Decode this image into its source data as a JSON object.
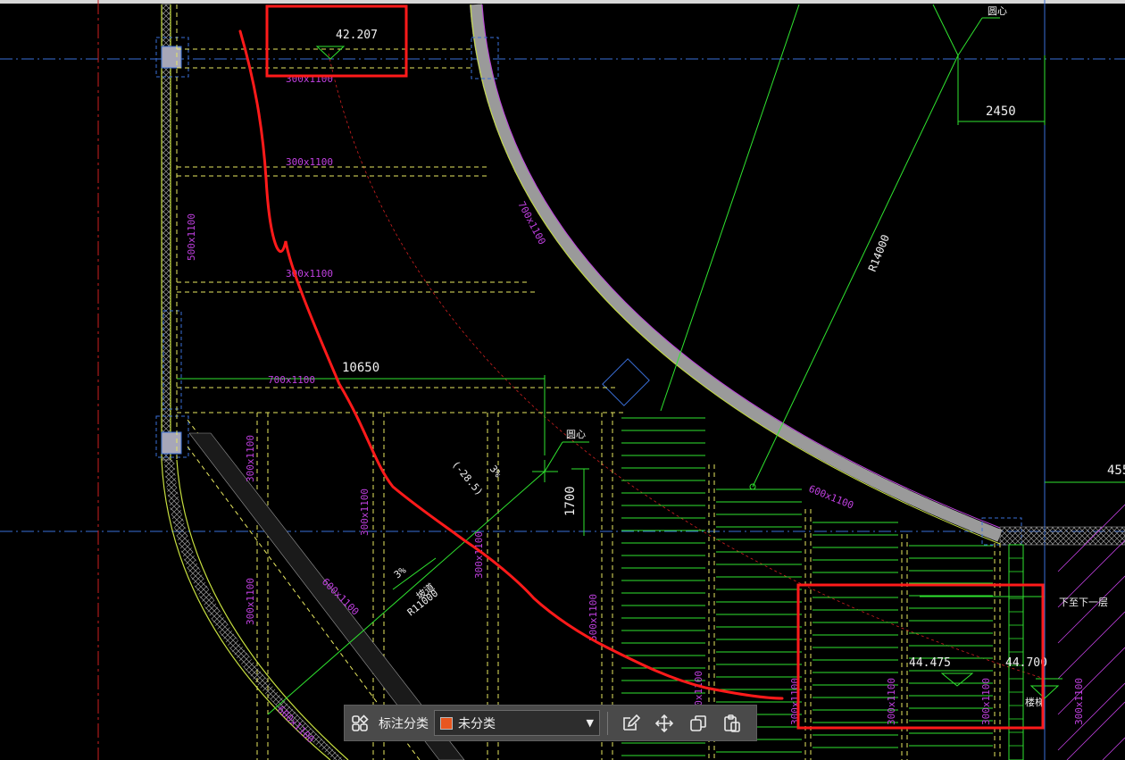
{
  "drawing": {
    "annotations": {
      "elev_1": "42.207",
      "elev_2": "44.475",
      "elev_3": "44.700",
      "dim_10650": "10650",
      "dim_2450": "2450",
      "dim_1700": "1700",
      "dim_455": "455",
      "radius_big": "R14000",
      "radius_ramp": "R11000",
      "slope_note": "3%",
      "slope_note_2": "3%",
      "center_mark_1": "圆心",
      "center_mark_2": "圆心",
      "ramp_label": "坡道",
      "down_note": "下至下一层",
      "stair_note": "楼梯",
      "elev_bracket": "(-28.5)"
    },
    "beams": {
      "b1": "300x1100",
      "b2": "300x1100",
      "b3": "300x1100",
      "b4": "700x1100",
      "b5": "500x1100",
      "b6": "700x1100",
      "b7": "300x1100",
      "b8": "300x1100",
      "b9": "600x1100",
      "b10": "300x1100",
      "b11": "500x1100",
      "b12": "600x1100",
      "b13": "300x1100",
      "b14": "600x1100",
      "b15": "300x1100",
      "b16": "300x1100",
      "b17": "300x1100",
      "b18": "300x1100",
      "b19": "300x1100"
    }
  },
  "toolbar": {
    "category_label": "标注分类",
    "category_value": "未分类",
    "category_color": "#e8561f",
    "icons": [
      "layout-grid-icon",
      "edit-icon",
      "move-icon",
      "copy-icon",
      "paste-icon"
    ]
  },
  "colors": {
    "markup_red": "#ff1a1a",
    "grid_blue": "#3a6fd8",
    "dim_green": "#2fe42f",
    "beam_yellow": "#e8e860",
    "text_magenta": "#c040e0",
    "hatch_gray": "#9a9a9a"
  }
}
